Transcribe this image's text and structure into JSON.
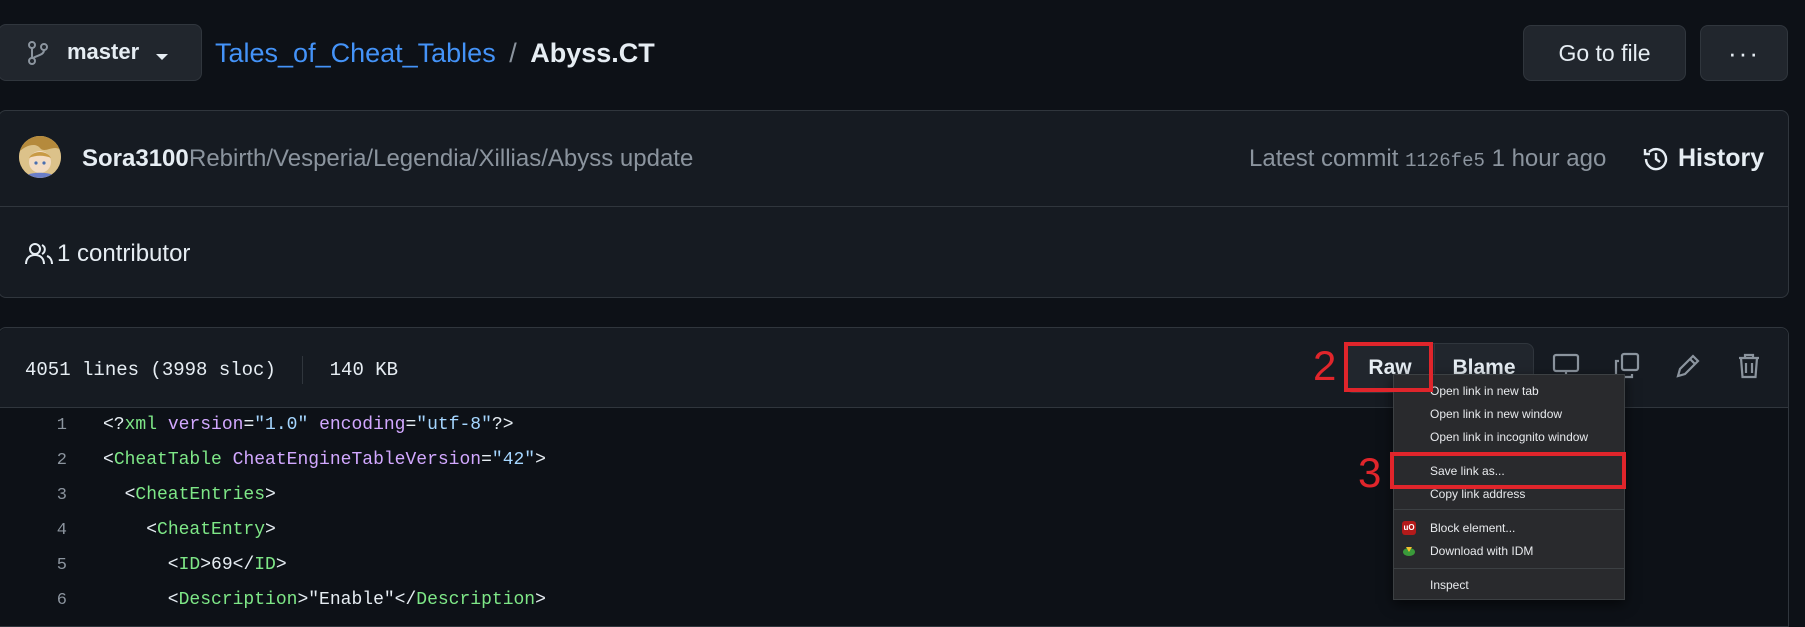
{
  "branch": {
    "name": "master"
  },
  "breadcrumb": {
    "repo": "Tales_of_Cheat_Tables",
    "separator": "/",
    "file": "Abyss.CT"
  },
  "header": {
    "go_to_file": "Go to file",
    "more": "···"
  },
  "commit": {
    "author": "Sora3100",
    "message": "Rebirth/Vesperia/Legendia/Xillias/Abyss update",
    "latest_label": "Latest commit",
    "sha": "1126fe5",
    "time": "1 hour ago",
    "history_label": "History"
  },
  "contributors": {
    "label": "1 contributor"
  },
  "file_info": {
    "lines": "4051 lines (3998 sloc)",
    "size": "140 KB"
  },
  "file_toolbar": {
    "raw": "Raw",
    "blame": "Blame"
  },
  "code_lines": [
    {
      "num": "1",
      "parts": [
        [
          "p",
          "<?"
        ],
        [
          "tag",
          "xml"
        ],
        [
          "attr",
          " version"
        ],
        [
          "p",
          "="
        ],
        [
          "str",
          "\"1.0\""
        ],
        [
          "attr",
          " encoding"
        ],
        [
          "p",
          "="
        ],
        [
          "str",
          "\"utf-8\""
        ],
        [
          "p",
          "?>"
        ]
      ]
    },
    {
      "num": "2",
      "parts": [
        [
          "p",
          "<"
        ],
        [
          "tag",
          "CheatTable"
        ],
        [
          "attr",
          " CheatEngineTableVersion"
        ],
        [
          "p",
          "="
        ],
        [
          "str",
          "\"42\""
        ],
        [
          "p",
          ">"
        ]
      ]
    },
    {
      "num": "3",
      "parts": [
        [
          "p",
          "  <"
        ],
        [
          "tag",
          "CheatEntries"
        ],
        [
          "p",
          ">"
        ]
      ]
    },
    {
      "num": "4",
      "parts": [
        [
          "p",
          "    <"
        ],
        [
          "tag",
          "CheatEntry"
        ],
        [
          "p",
          ">"
        ]
      ]
    },
    {
      "num": "5",
      "parts": [
        [
          "p",
          "      <"
        ],
        [
          "tag",
          "ID"
        ],
        [
          "p",
          ">69</"
        ],
        [
          "tag",
          "ID"
        ],
        [
          "p",
          ">"
        ]
      ]
    },
    {
      "num": "6",
      "parts": [
        [
          "p",
          "      <"
        ],
        [
          "tag",
          "Description"
        ],
        [
          "p",
          ">\"Enable\"</"
        ],
        [
          "tag",
          "Description"
        ],
        [
          "p",
          ">"
        ]
      ]
    }
  ],
  "context_menu": {
    "items": [
      "Open link in new tab",
      "Open link in new window",
      "Open link in incognito window",
      "Save link as...",
      "Copy link address",
      "Block element...",
      "Download with IDM",
      "Inspect"
    ]
  },
  "annotations": {
    "step2": "2",
    "step3": "3"
  },
  "colors": {
    "accent_link": "#4493f8",
    "annotation_red": "#e0252b",
    "bg": "#0d1117"
  }
}
